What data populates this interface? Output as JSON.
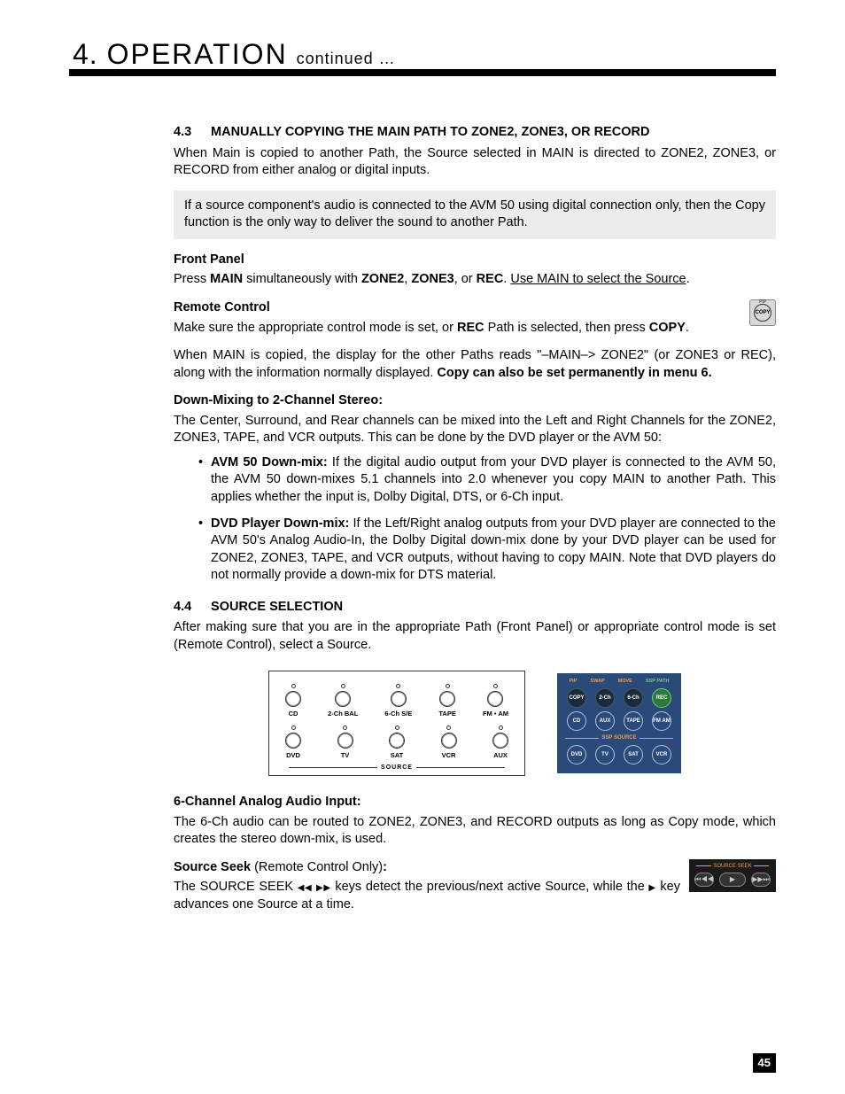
{
  "header": {
    "chapter_number": "4.",
    "chapter_word": "OPERATION",
    "continued": "continued …"
  },
  "page_number": "45",
  "section_43": {
    "num": "4.3",
    "title": "MANUALLY COPYING THE MAIN PATH TO ZONE2, ZONE3, OR RECORD",
    "intro": "When Main is copied to another Path, the Source selected in MAIN is directed to ZONE2, ZONE3, or RECORD from either analog or digital inputs.",
    "note": "If a source component's audio is connected to the AVM 50 using digital connection only, then the Copy function is the only way to deliver the sound to another Path.",
    "front_panel_head": "Front Panel",
    "front_panel_pre": "Press ",
    "front_panel_b1": "MAIN",
    "front_panel_mid1": " simultaneously with ",
    "front_panel_b2": "ZONE2",
    "front_panel_sep1": ", ",
    "front_panel_b3": "ZONE3",
    "front_panel_sep2": ", or ",
    "front_panel_b4": "REC",
    "front_panel_dot": ". ",
    "front_panel_u": "Use MAIN to select the Source",
    "front_panel_end": ".",
    "remote_head": "Remote Control",
    "remote_pre": "Make sure the appropriate control mode is set, or ",
    "remote_b1": "REC",
    "remote_mid": " Path is selected, then press ",
    "remote_b2": "COPY",
    "remote_end": ".",
    "copy_icon_outer": "PIP",
    "copy_icon_label": "COPY",
    "copied_para_pre": "When MAIN is copied, the display for the other Paths reads \"–MAIN–> ZONE2\" (or ZONE3 or REC), along with the information normally displayed. ",
    "copied_para_b": "Copy can also be set permanently in menu 6.",
    "downmix_head": "Down-Mixing to 2-Channel Stereo:",
    "downmix_para": "The Center, Surround, and Rear channels can be mixed into the Left and Right Channels for the ZONE2, ZONE3, TAPE, and VCR outputs. This can be done by the DVD player or the AVM 50:",
    "bullets": [
      {
        "lead": "AVM 50 Down-mix:",
        "body": "  If the digital audio output from your DVD player is connected to the AVM 50, the AVM 50 down-mixes 5.1 channels into 2.0 whenever you copy MAIN to another Path. This applies whether the input is, Dolby Digital, DTS, or 6-Ch input."
      },
      {
        "lead": "DVD Player Down-mix:",
        "body": "  If the Left/Right analog outputs from your DVD player are connected to the AVM 50's Analog Audio-In, the Dolby Digital down-mix done by your DVD player can be used for ZONE2, ZONE3, TAPE, and VCR outputs, without having to copy MAIN. Note that DVD players do not normally provide a down-mix for DTS material."
      }
    ]
  },
  "section_44": {
    "num": "4.4",
    "title": "SOURCE SELECTION",
    "intro": "After making sure that you are in the appropriate Path (Front Panel) or appropriate control mode is set (Remote Control), select a Source.",
    "panel_row1": [
      "CD",
      "2-Ch BAL",
      "6-Ch S/E",
      "TAPE",
      "FM • AM"
    ],
    "panel_row2": [
      "DVD",
      "TV",
      "SAT",
      "VCR",
      "AUX"
    ],
    "panel_bottom": "SOURCE",
    "remote_top_labels": [
      "PIP",
      "SWAP",
      "MOVE",
      "SSP PATH"
    ],
    "remote_row1": [
      "COPY",
      "2-Ch",
      "6-Ch",
      "REC"
    ],
    "remote_row2": [
      "CD",
      "AUX",
      "TAPE",
      "FM AM"
    ],
    "remote_mid_label": "SSP SOURCE",
    "remote_row3": [
      "DVD",
      "TV",
      "SAT",
      "VCR"
    ],
    "sixch_head": "6-Channel Analog Audio Input:",
    "sixch_body": "The 6-Ch audio can be routed to ZONE2, ZONE3, and RECORD outputs as long as Copy mode, which creates the stereo down-mix, is used.",
    "seek_head_b": "Source Seek",
    "seek_head_plain": " (Remote Control Only)",
    "seek_head_colon": ":",
    "seek_body_pre": "The SOURCE SEEK ",
    "seek_body_mid": " keys detect the previous/next active Source, while the ",
    "seek_body_end": " key advances one Source at a time.",
    "seek_label": "SOURCE SEEK",
    "seek_btn_prev": "⏮◀◀",
    "seek_btn_play": "▶",
    "seek_btn_next": "▶▶⏭",
    "rew_glyph": "◀◀",
    "fwd_glyph": "▶▶",
    "play_glyph": "▶"
  }
}
